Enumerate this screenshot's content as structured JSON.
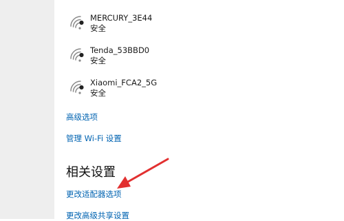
{
  "networks": [
    {
      "ssid": "MERCURY_3E44",
      "status": "安全"
    },
    {
      "ssid": "Tenda_53BBD0",
      "status": "安全"
    },
    {
      "ssid": "Xiaomi_FCA2_5G",
      "status": "安全"
    }
  ],
  "links": {
    "advanced_options": "高级选项",
    "manage_wifi": "管理 Wi-Fi 设置"
  },
  "related_settings": {
    "title": "相关设置",
    "change_adapter": "更改适配器选项",
    "change_sharing": "更改高级共享设置"
  },
  "annotation": {
    "arrow_color": "#e23030"
  },
  "colors": {
    "link": "#0063b1",
    "sidebar": "#eeeeee"
  },
  "icons": {
    "network": "wifi-secured-icon"
  }
}
